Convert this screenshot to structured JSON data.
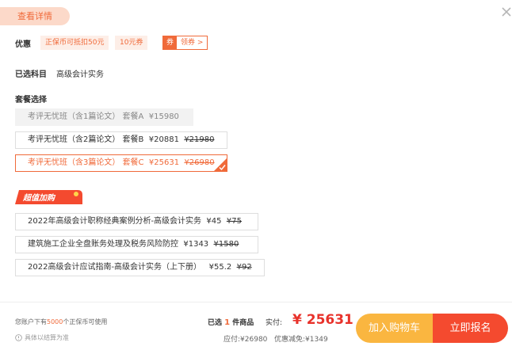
{
  "header": {
    "details_label": "查看详情"
  },
  "discount": {
    "label": "优惠",
    "coupons": [
      "正保币可抵扣50元",
      "10元券"
    ],
    "claim_tag": "券",
    "claim_label": "领券 >"
  },
  "subject": {
    "label": "已选科目",
    "value": "高级会计实务"
  },
  "packages": {
    "label": "套餐选择",
    "items": [
      {
        "name": "考评无忧班（含1篇论文） 套餐A",
        "price": "¥15980",
        "old_price": ""
      },
      {
        "name": "考评无忧班（含2篇论文） 套餐B",
        "price": "¥20881",
        "old_price": "¥21980"
      },
      {
        "name": "考评无忧班（含3篇论文） 套餐C",
        "price": "¥25631",
        "old_price": "¥26980"
      }
    ]
  },
  "addons": {
    "badge": "超值加购",
    "items": [
      {
        "name": "2022年高级会计职称经典案例分析-高级会计实务",
        "price": "¥45",
        "old_price": "¥75"
      },
      {
        "name": "建筑施工企业全盘账务处理及税务风险防控",
        "price": "¥1343",
        "old_price": "¥1580"
      },
      {
        "name": "2022高级会计应试指南-高级会计实务（上下册）",
        "price": "¥55.2",
        "old_price": "¥92"
      }
    ]
  },
  "footer": {
    "balance_pre": "您账户下有",
    "balance_amount": "5000",
    "balance_post": "个正保币可使用",
    "note": "具体以结算为准",
    "selected_pre": "已选",
    "selected_count": "1",
    "selected_post": "件商品",
    "pay_label": "实付:",
    "pay_value": "¥ 25631",
    "due_label": "应付:",
    "due_value": "¥26980",
    "saving_label": "优惠减免:",
    "saving_value": "¥1349",
    "cart_button": "加入购物车",
    "enroll_button": "立即报名"
  },
  "colors": {
    "accent": "#f06a3a",
    "price_red": "#e8322b",
    "cart_orange": "#fab640",
    "enroll_red": "#f44a2f"
  }
}
